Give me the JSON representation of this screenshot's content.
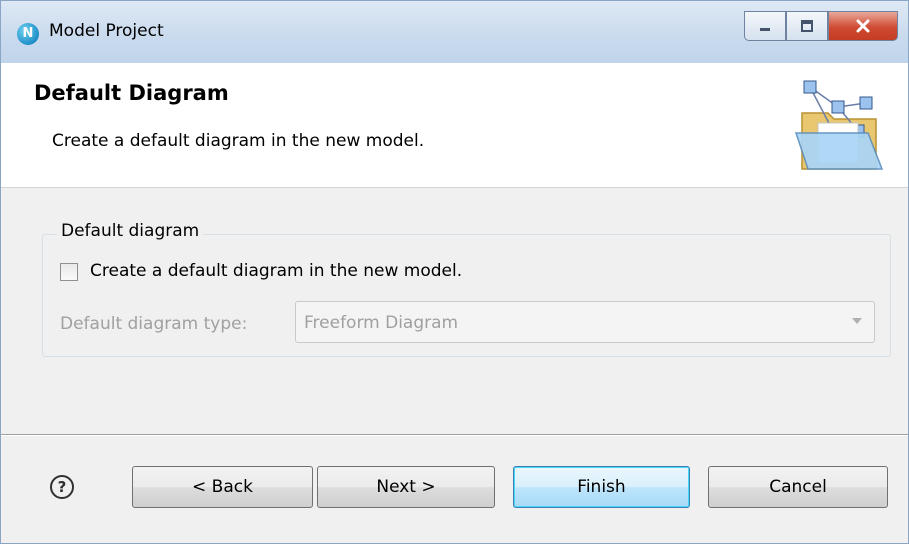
{
  "window": {
    "title": "Model Project",
    "controls": {
      "minimize": "minimize-icon",
      "maximize": "maximize-icon",
      "close": "close-icon"
    }
  },
  "header": {
    "title": "Default Diagram",
    "description": "Create a default diagram in the new model.",
    "graphic": "diagram-folder-icon"
  },
  "group": {
    "legend": "Default diagram",
    "checkbox_label": "Create a default diagram in the new model.",
    "checkbox_checked": false,
    "type_label": "Default diagram type:",
    "type_value": "Freeform Diagram",
    "type_enabled": false
  },
  "footer": {
    "help_icon": "help-icon",
    "back": "< Back",
    "next": "Next >",
    "finish": "Finish",
    "cancel": "Cancel"
  }
}
